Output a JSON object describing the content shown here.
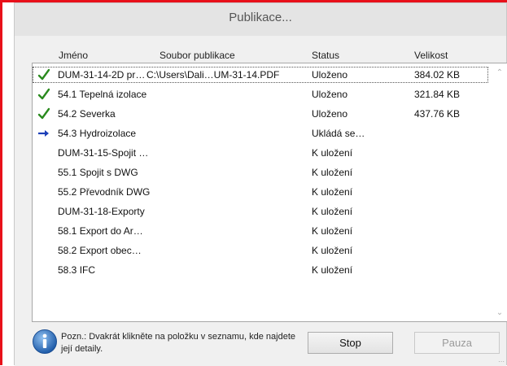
{
  "window": {
    "title": "Publikace..."
  },
  "columns": {
    "name": "Jméno",
    "file": "Soubor publikace",
    "status": "Status",
    "size": "Velikost"
  },
  "rows": [
    {
      "icon": "check-icon",
      "name": "DUM-31-14-2D pr…",
      "file": "C:\\Users\\Dali…UM-31-14.PDF",
      "status": "Uloženo",
      "size": "384.02 KB"
    },
    {
      "icon": "check-icon",
      "name": "54.1 Tepelná izolace",
      "file": "",
      "status": "Uloženo",
      "size": "321.84 KB"
    },
    {
      "icon": "check-icon",
      "name": "54.2 Severka",
      "file": "",
      "status": "Uloženo",
      "size": "437.76 KB"
    },
    {
      "icon": "arrow-right-icon",
      "name": "54.3 Hydroizolace",
      "file": "",
      "status": "Ukládá se…",
      "size": ""
    },
    {
      "icon": "",
      "name": "DUM-31-15-Spojit …",
      "file": "",
      "status": "K uložení",
      "size": ""
    },
    {
      "icon": "",
      "name": "55.1 Spojit s DWG",
      "file": "",
      "status": "K uložení",
      "size": ""
    },
    {
      "icon": "",
      "name": "55.2 Převodník DWG",
      "file": "",
      "status": "K uložení",
      "size": ""
    },
    {
      "icon": "",
      "name": "DUM-31-18-Exporty",
      "file": "",
      "status": "K uložení",
      "size": ""
    },
    {
      "icon": "",
      "name": "58.1 Export do Ar…",
      "file": "",
      "status": "K uložení",
      "size": ""
    },
    {
      "icon": "",
      "name": "58.2 Export obec…",
      "file": "",
      "status": "K uložení",
      "size": ""
    },
    {
      "icon": "",
      "name": "58.3 IFC",
      "file": "",
      "status": "K uložení",
      "size": ""
    }
  ],
  "footer": {
    "note": "Pozn.: Dvakrát klikněte na položku v seznamu, kde najdete její detaily.",
    "stop_label": "Stop",
    "pause_label": "Pauza"
  },
  "colors": {
    "check": "#2a8a1e",
    "arrow": "#1c3fb8",
    "info": "#2c6fc1",
    "border_highlight": "#e8101a"
  }
}
